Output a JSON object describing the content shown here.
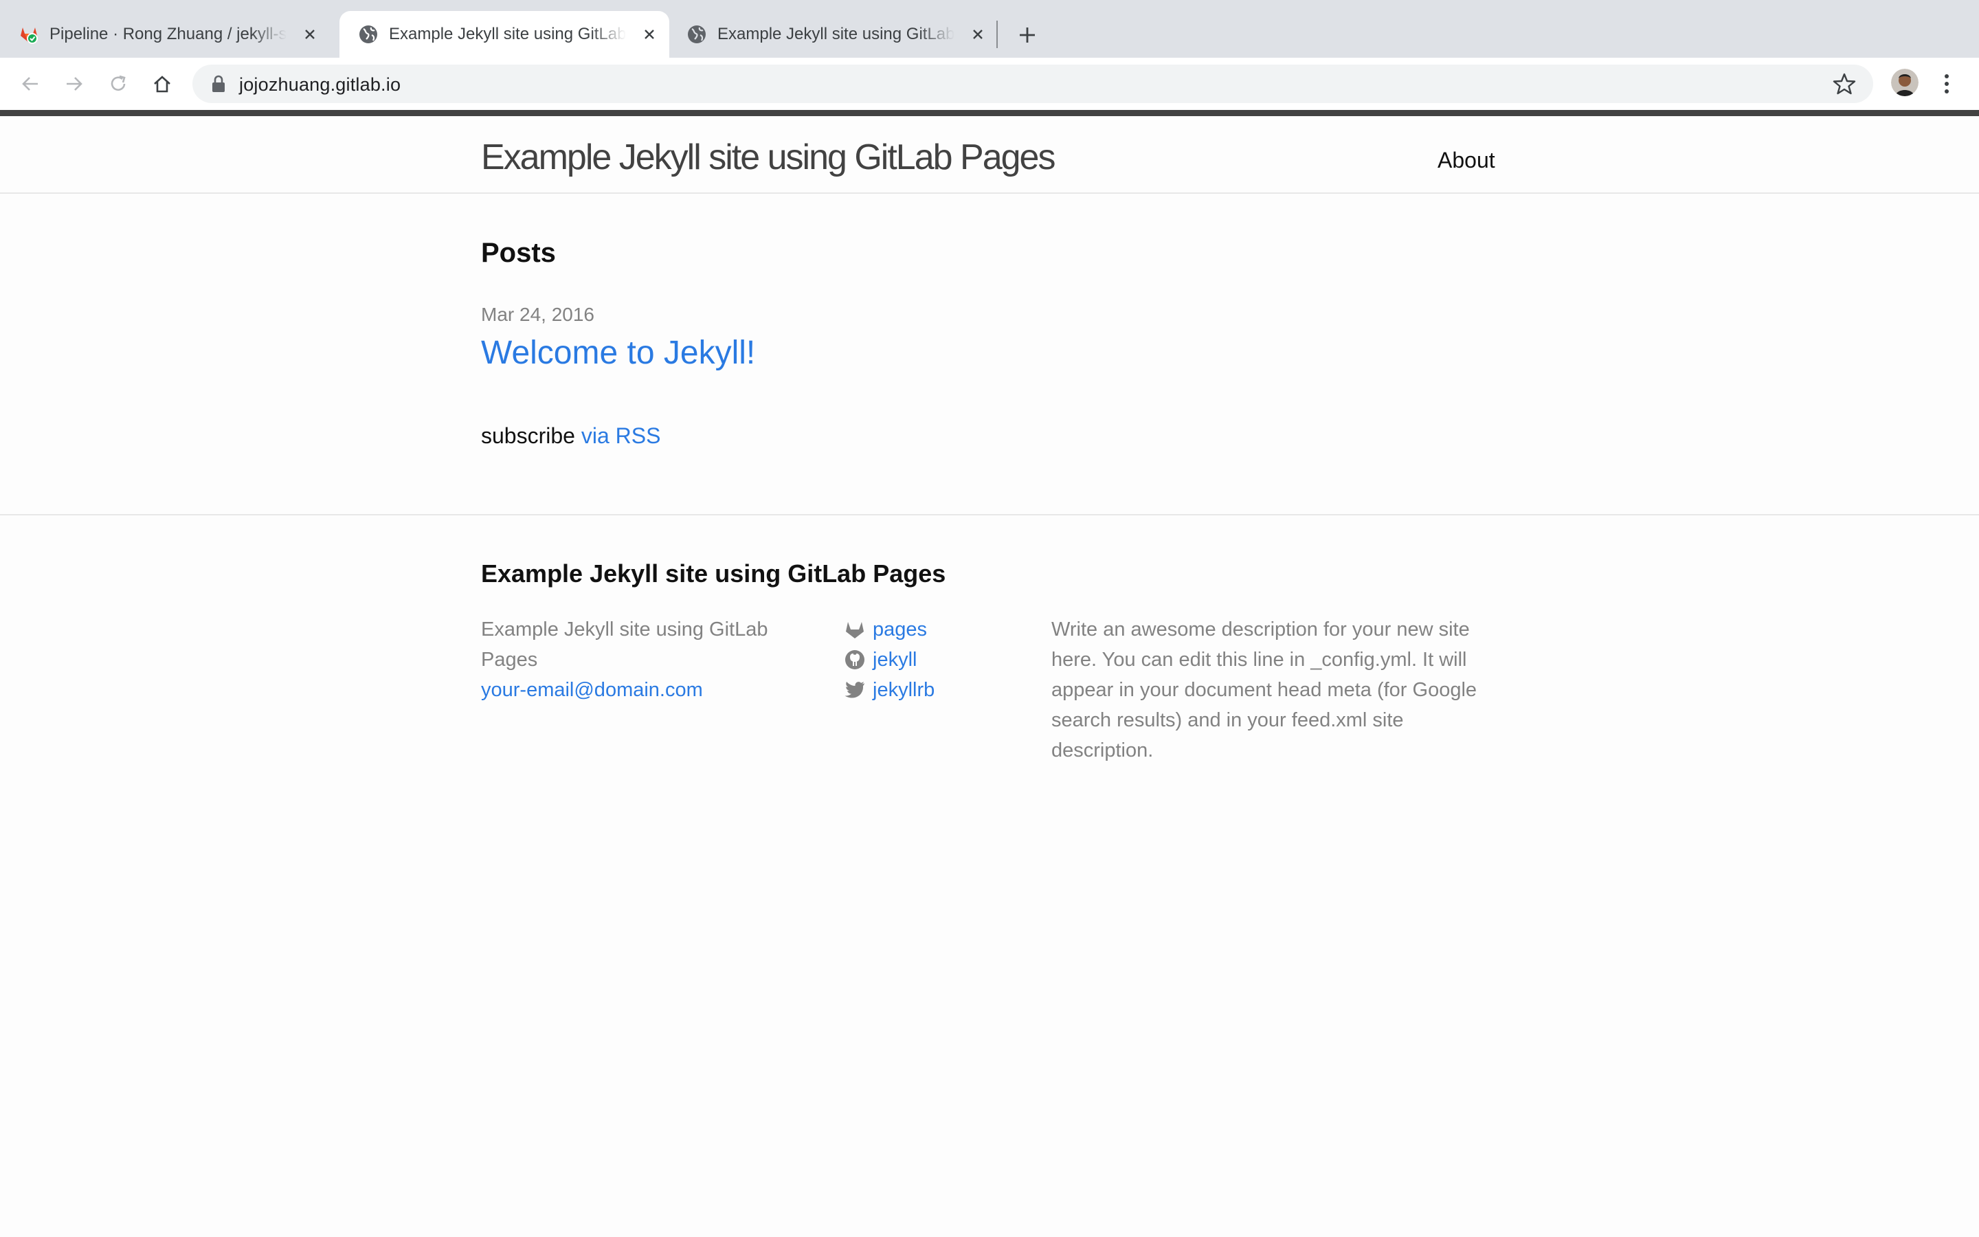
{
  "browser": {
    "tabs": [
      {
        "title": "Pipeline · Rong Zhuang / jekyll-site",
        "active": false,
        "favicon": "gitlab-icon"
      },
      {
        "title": "Example Jekyll site using GitLab Pages",
        "active": true,
        "favicon": "globe-icon"
      },
      {
        "title": "Example Jekyll site using GitLab Pages",
        "active": false,
        "favicon": "globe-icon"
      }
    ],
    "url": "jojozhuang.gitlab.io"
  },
  "header": {
    "site_title": "Example Jekyll site using GitLab Pages",
    "nav_about": "About"
  },
  "main": {
    "heading": "Posts",
    "posts": [
      {
        "date": "Mar 24, 2016",
        "title": "Welcome to Jekyll!"
      }
    ],
    "rss_prefix": "subscribe",
    "rss_link": "via RSS"
  },
  "footer": {
    "heading": "Example Jekyll site using GitLab Pages",
    "name": "Example Jekyll site using GitLab Pages",
    "email": "your-email@domain.com",
    "social": [
      {
        "icon": "gitlab-icon",
        "label": "pages"
      },
      {
        "icon": "github-icon",
        "label": "jekyll"
      },
      {
        "icon": "twitter-icon",
        "label": "jekyllrb"
      }
    ],
    "description": "Write an awesome description for your new site here. You can edit this line in _config.yml. It will appear in your document head meta (for Google search results) and in your feed.xml site description."
  },
  "colors": {
    "link": "#2a7ae2",
    "text": "#111111",
    "muted": "#828282",
    "header_rule": "#424242"
  }
}
